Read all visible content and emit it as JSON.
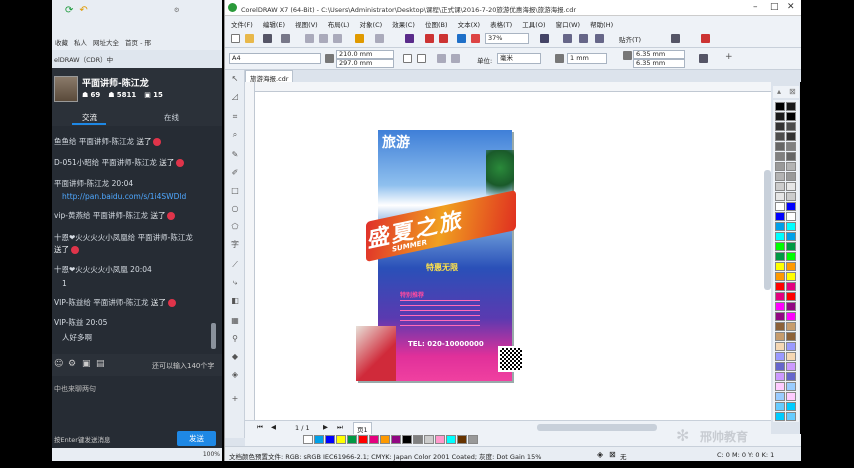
{
  "chat": {
    "toolbar_items": [
      "收藏",
      "私人",
      "网址大全",
      "首页 - 邢"
    ],
    "tab_title": "elDRAW（CDR）中",
    "teacher_name": "平面讲师-陈江龙",
    "stat1": "69",
    "stat2": "5811",
    "stat3": "15",
    "tab_chat": "交流",
    "tab_online": "在线",
    "messages": [
      {
        "user": "鱼鱼给",
        "target": " 平面讲师-陈江龙 ",
        "action": "送了"
      },
      {
        "user": "D-051小昭给",
        "target": " 平面讲师-陈江龙 ",
        "action": "送了"
      },
      {
        "user": "平面讲师-陈江龙 20:04",
        "target": "",
        "action": ""
      },
      {
        "user": "http://pan.baidu.com/s/1i4SWDld",
        "target": "",
        "action": ""
      },
      {
        "user": "vip-黄燕给",
        "target": " 平面讲师-陈江龙 ",
        "action": "送了"
      },
      {
        "user": "十恩❤火火火火小凤凰给",
        "target": " 平面讲师-陈江龙",
        "action": ""
      },
      {
        "user": "送了",
        "target": "",
        "action": ""
      },
      {
        "user": "十恩❤火火火火小凤凰 20:04",
        "target": "",
        "action": ""
      },
      {
        "user": "1",
        "target": "",
        "action": ""
      },
      {
        "user": "VIP-陈益给",
        "target": " 平面讲师-陈江龙 ",
        "action": "送了"
      },
      {
        "user": "VIP-陈益 20:05",
        "target": "",
        "action": ""
      },
      {
        "user": "人好多啊",
        "target": "",
        "action": ""
      }
    ],
    "remaining": "还可以输入140个字",
    "input_text": "中也来聊两句",
    "enter_hint": "按Enter键发送消息",
    "send_label": "发送",
    "zoom": "100%"
  },
  "corel": {
    "title": "CorelDRAW X7 (64-Bit) - C:\\Users\\Administrator\\Desktop\\课程\\正式课\\2016-7-20旅游优惠海报\\旅游海报.cdr",
    "menus": [
      "文件(F)",
      "编辑(E)",
      "视图(V)",
      "布局(L)",
      "对象(C)",
      "效果(C)",
      "位图(B)",
      "文本(X)",
      "表格(T)",
      "工具(O)",
      "窗口(W)",
      "帮助(H)"
    ],
    "zoom_value": "37%",
    "snap_label": "贴齐(T)",
    "page_size": "A4",
    "width": "210.0 mm",
    "height": "297.0 mm",
    "unit_label": "单位:",
    "unit_value": "毫米",
    "nudge": "1 mm",
    "dup_x": "6.35 mm",
    "dup_y": "6.35 mm",
    "doc_tab": "旅游海报.cdr",
    "page_nav": "1 / 1",
    "page_tab": "页1",
    "status": "文档颜色预置文件: RGB: sRGB IEC61966-2.1; CMYK: Japan Color 2001 Coated; 灰度: Dot Gain 15%",
    "fill_none": "无",
    "color_readout": "C: 0 M: 0 Y: 0 K: 1"
  },
  "poster": {
    "logo": "旅游",
    "headline": "盛夏之旅",
    "sub": "SUMMER",
    "tag": "特惠无限",
    "section": "特别推荐",
    "tel": "TEL: 020-10000000"
  },
  "watermark": "邢帅教育",
  "colors": {
    "palette": [
      "#000000",
      "#1a1a1a",
      "#333333",
      "#4d4d4d",
      "#666666",
      "#808080",
      "#999999",
      "#b3b3b3",
      "#cccccc",
      "#e6e6e6",
      "#ffffff",
      "#0000ff",
      "#00a0e9",
      "#00ffff",
      "#00ff00",
      "#009944",
      "#ffff00",
      "#ff9900",
      "#ff0000",
      "#e4007f",
      "#ff00ff",
      "#920783",
      "#8c6239",
      "#c69c6d",
      "#f5d7b3",
      "#9999ff",
      "#6666cc",
      "#cc99ff",
      "#ffccff",
      "#99ccff",
      "#66ccff",
      "#00ccff"
    ],
    "row": [
      "#ffffff",
      "#00a0e9",
      "#0000ff",
      "#ffff00",
      "#009944",
      "#ff0000",
      "#e4007f",
      "#ff9900",
      "#920783",
      "#000000",
      "#808080",
      "#cccccc",
      "#ff99cc",
      "#00ffff",
      "#663300",
      "#999999"
    ]
  }
}
